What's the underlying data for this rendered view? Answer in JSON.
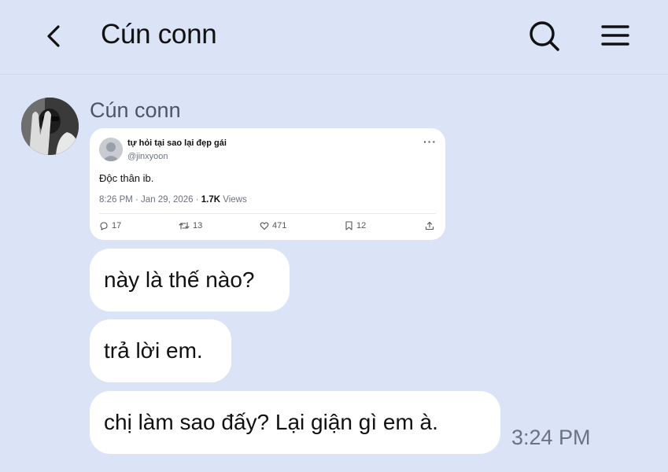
{
  "header": {
    "title": "Cún conn"
  },
  "message": {
    "sender_name": "Cún conn",
    "tweet": {
      "display_name": "tự hỏi tại sao lại đẹp gái",
      "handle": "@jinxyoon",
      "more": "···",
      "text": "Độc thân ib.",
      "meta_prefix": "8:26 PM · Jan 29, 2026 · ",
      "views_count": "1.7K",
      "views_label": " Views",
      "replies": "17",
      "retweets": "13",
      "likes": "471",
      "bookmarks": "12"
    },
    "bubbles": [
      "này là thế nào?",
      "trả lời em.",
      "chị làm sao đấy? Lại giận gì em à."
    ],
    "time": "3:24 PM"
  },
  "icons": {
    "back": "chevron-left-icon",
    "search": "search-icon",
    "menu": "menu-icon",
    "reply": "comment-icon",
    "retweet": "retweet-icon",
    "like": "heart-icon",
    "bookmark": "bookmark-icon",
    "share": "share-icon"
  }
}
